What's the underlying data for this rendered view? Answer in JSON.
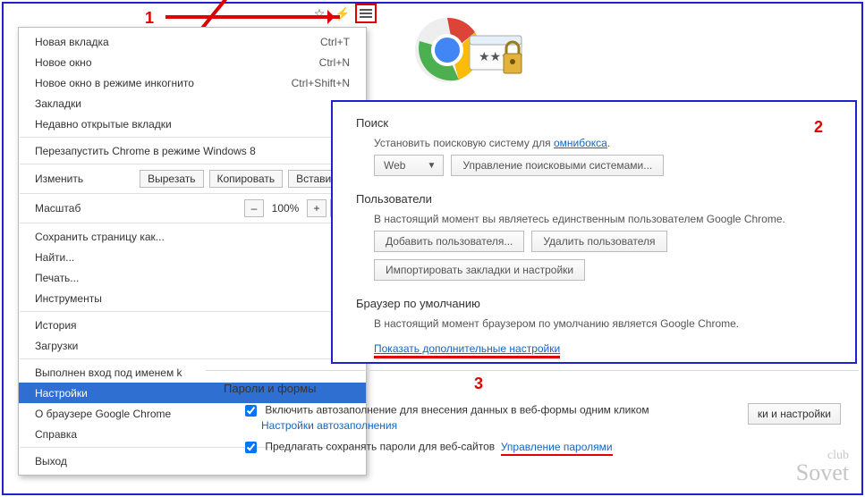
{
  "annotations": {
    "n1": "1",
    "n2": "2",
    "n3": "3"
  },
  "menu": {
    "new_tab": "Новая вкладка",
    "new_tab_accel": "Ctrl+T",
    "new_window": "Новое окно",
    "new_window_accel": "Ctrl+N",
    "incognito": "Новое окно в режиме инкогнито",
    "incognito_accel": "Ctrl+Shift+N",
    "bookmarks": "Закладки",
    "recent_tabs": "Недавно открытые вкладки",
    "relaunch_win8": "Перезапустить Chrome в режиме Windows 8",
    "edit_label": "Изменить",
    "cut": "Вырезать",
    "copy": "Копировать",
    "paste": "Вставить",
    "zoom_label": "Масштаб",
    "zoom_value": "100%",
    "save_page": "Сохранить страницу как...",
    "find": "Найти...",
    "print": "Печать...",
    "tools": "Инструменты",
    "history": "История",
    "downloads": "Загрузки",
    "signin": "Выполнен вход под именем k",
    "settings": "Настройки",
    "about": "О браузере Google Chrome",
    "help": "Справка",
    "exit": "Выход"
  },
  "settings": {
    "search_title": "Поиск",
    "search_desc_pre": "Установить поисковую систему для ",
    "omnibox_link": "омнибокса",
    "search_desc_post": ".",
    "select_value": "Web",
    "manage_engines": "Управление поисковыми системами...",
    "users_title": "Пользователи",
    "users_desc": "В настоящий момент вы являетесь единственным пользователем Google Chrome.",
    "add_user": "Добавить пользователя...",
    "delete_user": "Удалить пользователя",
    "import": "Импортировать закладки и настройки",
    "default_title": "Браузер по умолчанию",
    "default_desc": "В настоящий момент браузером по умолчанию является Google Chrome.",
    "advanced": "Показать дополнительные настройки"
  },
  "pwd": {
    "title": "Пароли и формы",
    "autofill": "Включить автозаполнение для внесения данных в веб-формы одним кликом",
    "autofill_link": "Настройки автозаполнения",
    "save_pw": "Предлагать сохранять пароли для веб-сайтов",
    "manage_pw": "Управление паролями",
    "ghost_btn": "ки и настройки"
  },
  "watermark": {
    "top": "club",
    "bottom": "Sovet"
  }
}
